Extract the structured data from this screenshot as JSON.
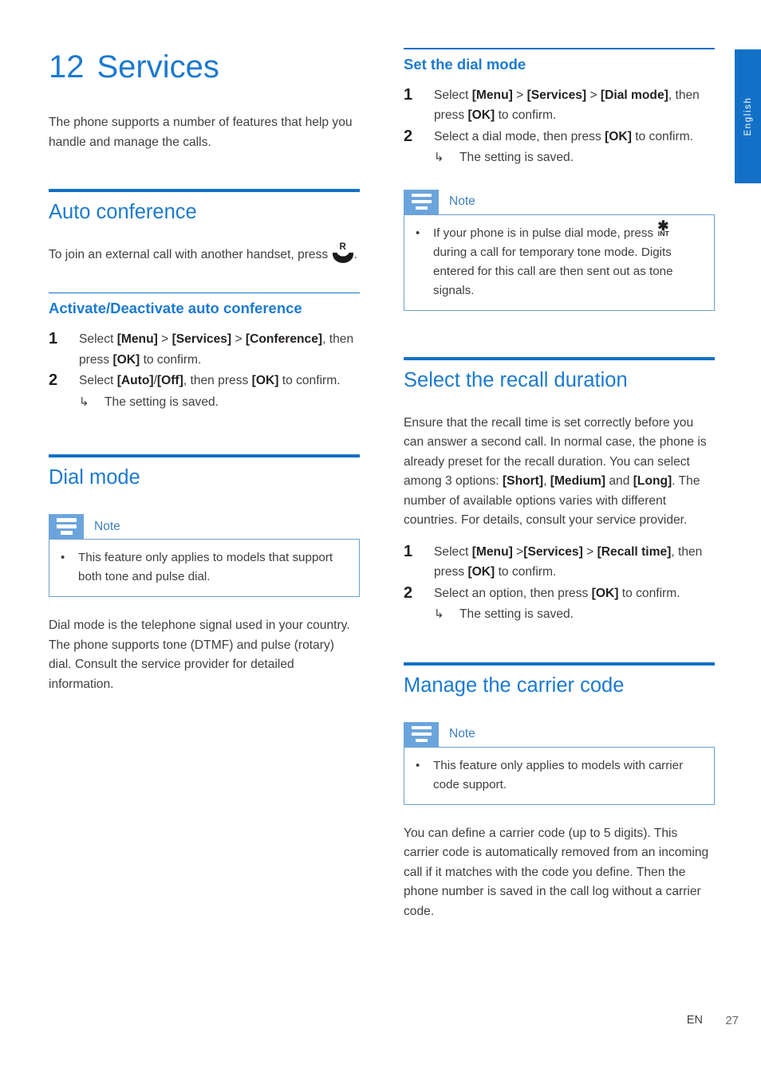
{
  "page": {
    "language_tab": "English",
    "footer_language": "EN",
    "footer_page_number": "27",
    "accent_blue": "#1271c7",
    "heading_blue": "#1c7ad0",
    "note_badge_blue": "#6ba4dc",
    "note_label_blue": "#3c7fc0",
    "note_border_blue": "#6d9fd0",
    "body_text_color": "#3f3f3f"
  },
  "chapter": {
    "number": "12",
    "title": "Services",
    "intro": "The phone supports a number of features that help you handle and manage the calls."
  },
  "left_column": {
    "auto_conference": {
      "heading": "Auto conference",
      "intro_before_icon": "To join an external call with another handset, press ",
      "icon_name": "recall-key-icon",
      "icon_letter": "R",
      "intro_after_icon": ".",
      "subheading": "Activate/Deactivate auto conference",
      "steps": [
        {
          "number": "1",
          "parts": [
            {
              "text": "Select ",
              "bold": false
            },
            {
              "text": "[Menu]",
              "bold": true
            },
            {
              "text": " > ",
              "bold": false
            },
            {
              "text": "[Services]",
              "bold": true
            },
            {
              "text": " > ",
              "bold": false
            },
            {
              "text": "[Conference]",
              "bold": true
            },
            {
              "text": ", then press ",
              "bold": false
            },
            {
              "text": "[OK]",
              "bold": true
            },
            {
              "text": " to confirm.",
              "bold": false
            }
          ]
        },
        {
          "number": "2",
          "parts": [
            {
              "text": "Select ",
              "bold": false
            },
            {
              "text": "[Auto]",
              "bold": true
            },
            {
              "text": "/",
              "bold": false
            },
            {
              "text": "[Off]",
              "bold": true
            },
            {
              "text": ", then press ",
              "bold": false
            },
            {
              "text": "[OK]",
              "bold": true
            },
            {
              "text": " to confirm.",
              "bold": false
            }
          ],
          "result_arrow": "↳",
          "result": "The setting is saved."
        }
      ]
    },
    "dial_mode": {
      "heading": "Dial mode",
      "note": {
        "label": "Note",
        "bullet": "•",
        "items": [
          "This feature only applies to models that support both tone and pulse dial."
        ]
      },
      "body": "Dial mode is the telephone signal used in your country. The phone supports tone (DTMF) and pulse (rotary) dial. Consult the service provider for detailed information."
    }
  },
  "right_column": {
    "set_dial_mode": {
      "subheading": "Set the dial mode",
      "steps": [
        {
          "number": "1",
          "parts": [
            {
              "text": "Select ",
              "bold": false
            },
            {
              "text": "[Menu]",
              "bold": true
            },
            {
              "text": " > ",
              "bold": false
            },
            {
              "text": "[Services]",
              "bold": true
            },
            {
              "text": " > ",
              "bold": false
            },
            {
              "text": "[Dial mode]",
              "bold": true
            },
            {
              "text": ", then press ",
              "bold": false
            },
            {
              "text": "[OK]",
              "bold": true
            },
            {
              "text": " to confirm.",
              "bold": false
            }
          ]
        },
        {
          "number": "2",
          "parts": [
            {
              "text": "Select a dial mode, then press ",
              "bold": false
            },
            {
              "text": "[OK]",
              "bold": true
            },
            {
              "text": " to confirm.",
              "bold": false
            }
          ],
          "result_arrow": "↳",
          "result": "The setting is saved."
        }
      ],
      "note": {
        "label": "Note",
        "bullet": "•",
        "item_before_icon": "If your phone is in pulse dial mode, press ",
        "icon_name": "int-star-key-icon",
        "icon_star": "✱",
        "icon_sub": "INT",
        "item_after_icon": " during a call for temporary tone mode. Digits entered for this call are then sent out as tone signals."
      }
    },
    "recall_duration": {
      "heading": "Select the recall duration",
      "body_parts": [
        {
          "text": "Ensure that the recall time is set correctly before you can answer a second call. In normal case, the phone is already preset for the recall duration. You can select among 3 options: ",
          "bold": false
        },
        {
          "text": "[Short]",
          "bold": true
        },
        {
          "text": ", ",
          "bold": false
        },
        {
          "text": "[Medium]",
          "bold": true
        },
        {
          "text": " and ",
          "bold": false
        },
        {
          "text": "[Long]",
          "bold": true
        },
        {
          "text": ". The number of available options varies with different countries. For details, consult your service provider.",
          "bold": false
        }
      ],
      "steps": [
        {
          "number": "1",
          "parts": [
            {
              "text": "Select ",
              "bold": false
            },
            {
              "text": "[Menu]",
              "bold": true
            },
            {
              "text": " >",
              "bold": false
            },
            {
              "text": "[Services]",
              "bold": true
            },
            {
              "text": " > ",
              "bold": false
            },
            {
              "text": "[Recall time]",
              "bold": true
            },
            {
              "text": ", then press ",
              "bold": false
            },
            {
              "text": "[OK]",
              "bold": true
            },
            {
              "text": " to confirm.",
              "bold": false
            }
          ]
        },
        {
          "number": "2",
          "parts": [
            {
              "text": "Select an option, then press ",
              "bold": false
            },
            {
              "text": "[OK]",
              "bold": true
            },
            {
              "text": " to confirm.",
              "bold": false
            }
          ],
          "result_arrow": "↳",
          "result": "The setting is saved."
        }
      ]
    },
    "carrier_code": {
      "heading": "Manage the carrier code",
      "note": {
        "label": "Note",
        "bullet": "•",
        "items": [
          "This feature only applies to models with carrier code support."
        ]
      },
      "body": "You can define a carrier code (up to 5 digits). This carrier code is automatically removed from an incoming call if it matches with the code you define. Then the phone number is saved in the call log without a carrier code."
    }
  }
}
